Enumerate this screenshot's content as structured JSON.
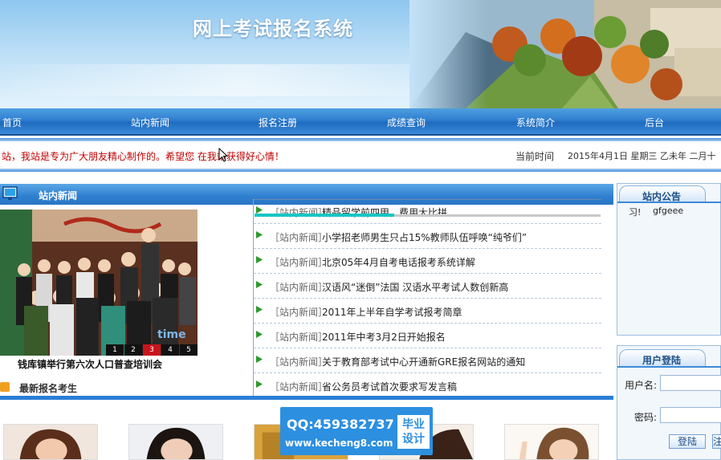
{
  "header": {
    "title": "网上考试报名系统"
  },
  "nav": {
    "items": [
      {
        "label": "首页"
      },
      {
        "label": "站内新闻"
      },
      {
        "label": "报名注册"
      },
      {
        "label": "成绩查询"
      },
      {
        "label": "系统简介"
      },
      {
        "label": "后台"
      }
    ]
  },
  "marquee": {
    "text": "站，我站是专为广大朋友精心制作的。希望您 在我站获得好心情！",
    "clock_label": "当前时间",
    "clock_value": "2015年4月1日  星期三  乙未年  二月十"
  },
  "news": {
    "header": "站内新闻",
    "photo_caption": "钱库镇举行第六次人口普查培训会",
    "pager": [
      "1",
      "2",
      "3",
      "4",
      "5"
    ],
    "items": [
      {
        "category": "［站内新闻］",
        "title": "精品留学前四甲，费用大比拼"
      },
      {
        "category": "［站内新闻］",
        "title": "小学招老师男生只占15%教师队伍呼唤“纯爷们”"
      },
      {
        "category": "［站内新闻］",
        "title": "北京05年4月自考电话报考系统详解"
      },
      {
        "category": "［站内新闻］",
        "title": "汉语风“迷倒”法国 汉语水平考试人数创新高"
      },
      {
        "category": "［站内新闻］",
        "title": "2011年上半年自学考试报考简章"
      },
      {
        "category": "［站内新闻］",
        "title": "2011年中考3月2日开始报名"
      },
      {
        "category": "［站内新闻］",
        "title": "关于教育部考试中心开通新GRE报名网站的通知"
      },
      {
        "category": "［站内新闻］",
        "title": "省公务员考试首次要求写发言稿"
      }
    ]
  },
  "latest": {
    "header": "最新报名考生"
  },
  "sidebar": {
    "notice": {
      "header": "站内公告",
      "prefix": "习!",
      "body": "gfgeee"
    },
    "login": {
      "header": "用户登陆",
      "username_label": "用户名:",
      "password_label": "密码:",
      "login_button": "登陆",
      "second_button": "注"
    }
  },
  "watermark": {
    "qq": "QQ:459382737",
    "site": "www.kecheng8.com",
    "seal_line1": "毕业",
    "seal_line2": "设计"
  },
  "colors": {
    "nav_blue": "#2f7fd0",
    "marquee_red": "#c00000",
    "accent_cyan": "#18c6c6",
    "watermark_blue": "#2c8fe0"
  },
  "icons": {
    "news": "monitor-icon",
    "latest": "folder-icon",
    "row": "green-arrow-icon"
  }
}
